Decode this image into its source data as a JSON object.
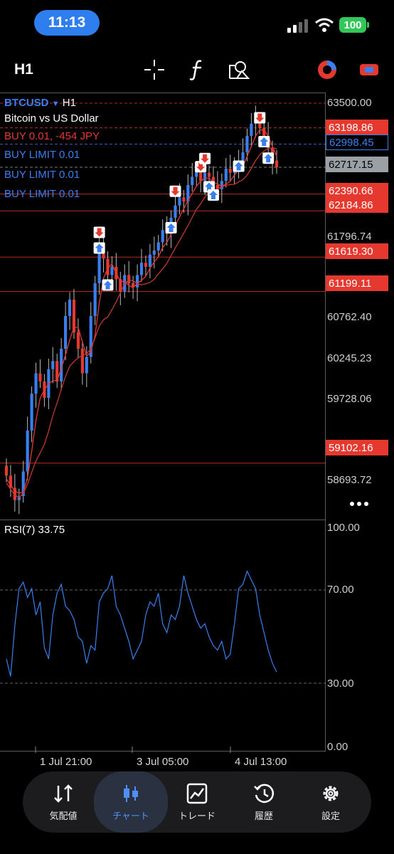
{
  "status_bar": {
    "time": "11:13",
    "battery": "100"
  },
  "toolbar": {
    "timeframe": "H1",
    "icons": [
      "crosshair-icon",
      "function-icon",
      "objects-icon",
      "indicator-icon",
      "switch-icon"
    ]
  },
  "chart": {
    "symbol": "BTCUSD",
    "symbol_timeframe": "H1",
    "description": "Bitcoin vs US Dollar",
    "order_lines": [
      "BUY 0.01, -454 JPY",
      "BUY LIMIT 0.01",
      "BUY LIMIT 0.01",
      "BUY LIMIT 0.01"
    ],
    "price_scale": [
      "63500.00",
      "61796.74",
      "60762.40",
      "60245.23",
      "59728.06",
      "58693.72"
    ],
    "price_boxes": [
      "63198.86",
      "62998.45",
      "62717.15",
      "62390.66",
      "62184.86",
      "61619.30",
      "61199.11",
      "59102.16"
    ],
    "time_labels": [
      "1 Jul 21:00",
      "3 Jul 05:00",
      "4 Jul 13:00"
    ],
    "colors": {
      "bull": "#3a7ff0",
      "bear": "#e5392f",
      "ma": "#e5392f",
      "current": "#9aa0a6"
    }
  },
  "rsi": {
    "label": "RSI(7)",
    "value": "33.75",
    "scale": [
      "100.00",
      "70.00",
      "30.00",
      "0.00"
    ],
    "color": "#3a7ff0"
  },
  "nav": {
    "items": [
      {
        "label": "気配値",
        "icon": "quotes-icon"
      },
      {
        "label": "チャート",
        "icon": "chart-icon"
      },
      {
        "label": "トレード",
        "icon": "trade-icon"
      },
      {
        "label": "履歴",
        "icon": "history-icon"
      },
      {
        "label": "設定",
        "icon": "settings-icon"
      }
    ],
    "active": 1
  },
  "chart_data": {
    "type": "candlestick",
    "timeframe": "H1",
    "x_labels": [
      "1 Jul 21:00",
      "3 Jul 05:00",
      "4 Jul 13:00"
    ],
    "ylim": [
      58500,
      63500
    ],
    "close": [
      58950,
      58800,
      58650,
      58700,
      59000,
      59500,
      59950,
      60200,
      60100,
      59900,
      60250,
      60350,
      60100,
      60500,
      60900,
      61100,
      60700,
      60500,
      60200,
      60400,
      60900,
      61300,
      61800,
      61600,
      61400,
      61500,
      61350,
      61200,
      61400,
      61300,
      61250,
      61400,
      61550,
      61500,
      61650,
      61700,
      61800,
      61950,
      61900,
      62100,
      62250,
      62350,
      62300,
      62500,
      62600,
      62700,
      62550,
      62650,
      62600,
      62500,
      62450,
      62550,
      62700,
      62650,
      62750,
      62800,
      62900,
      63100,
      63250,
      63300,
      63200,
      63100,
      62950,
      62800,
      62717
    ],
    "rsi7": [
      40,
      32,
      55,
      72,
      75,
      68,
      72,
      60,
      66,
      45,
      40,
      60,
      70,
      74,
      64,
      62,
      58,
      50,
      48,
      38,
      46,
      44,
      66,
      70,
      72,
      78,
      64,
      60,
      54,
      48,
      40,
      44,
      48,
      60,
      66,
      64,
      70,
      56,
      52,
      60,
      58,
      64,
      78,
      70,
      64,
      58,
      54,
      56,
      50,
      46,
      44,
      48,
      40,
      42,
      56,
      72,
      74,
      80,
      76,
      72,
      60,
      52,
      44,
      38,
      34
    ],
    "rsi_scale": [
      100,
      70,
      30,
      0
    ]
  }
}
